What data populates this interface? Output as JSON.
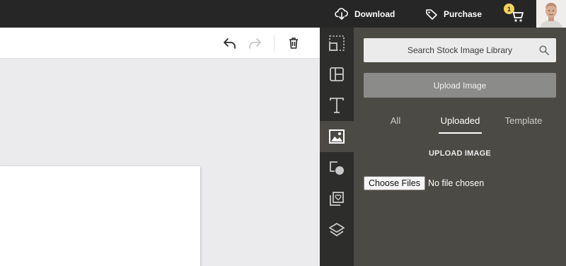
{
  "topbar": {
    "download_label": "Download",
    "purchase_label": "Purchase",
    "cart_count": "1"
  },
  "panel": {
    "search_label": "Search Stock Image Library",
    "upload_button_label": "Upload Image",
    "tabs": [
      {
        "label": "All",
        "active": false
      },
      {
        "label": "Uploaded",
        "active": true
      },
      {
        "label": "Template",
        "active": false
      }
    ],
    "section_title": "UPLOAD IMAGE",
    "file_button_label": "Choose Files",
    "file_status": "No file chosen"
  },
  "rail": {
    "items": [
      "crop-icon",
      "layout-icon",
      "text-icon",
      "image-icon",
      "shapes-icon",
      "favorites-icon",
      "layers-icon"
    ],
    "active": "image-icon"
  },
  "toolbar": {
    "icons": [
      "undo-icon",
      "redo-icon",
      "delete-icon"
    ]
  },
  "colors": {
    "topbar": "#262626",
    "rail": "#2d2d2c",
    "panel": "#4c4a44",
    "badge": "#f4d35e",
    "workspace": "#ebebed"
  }
}
